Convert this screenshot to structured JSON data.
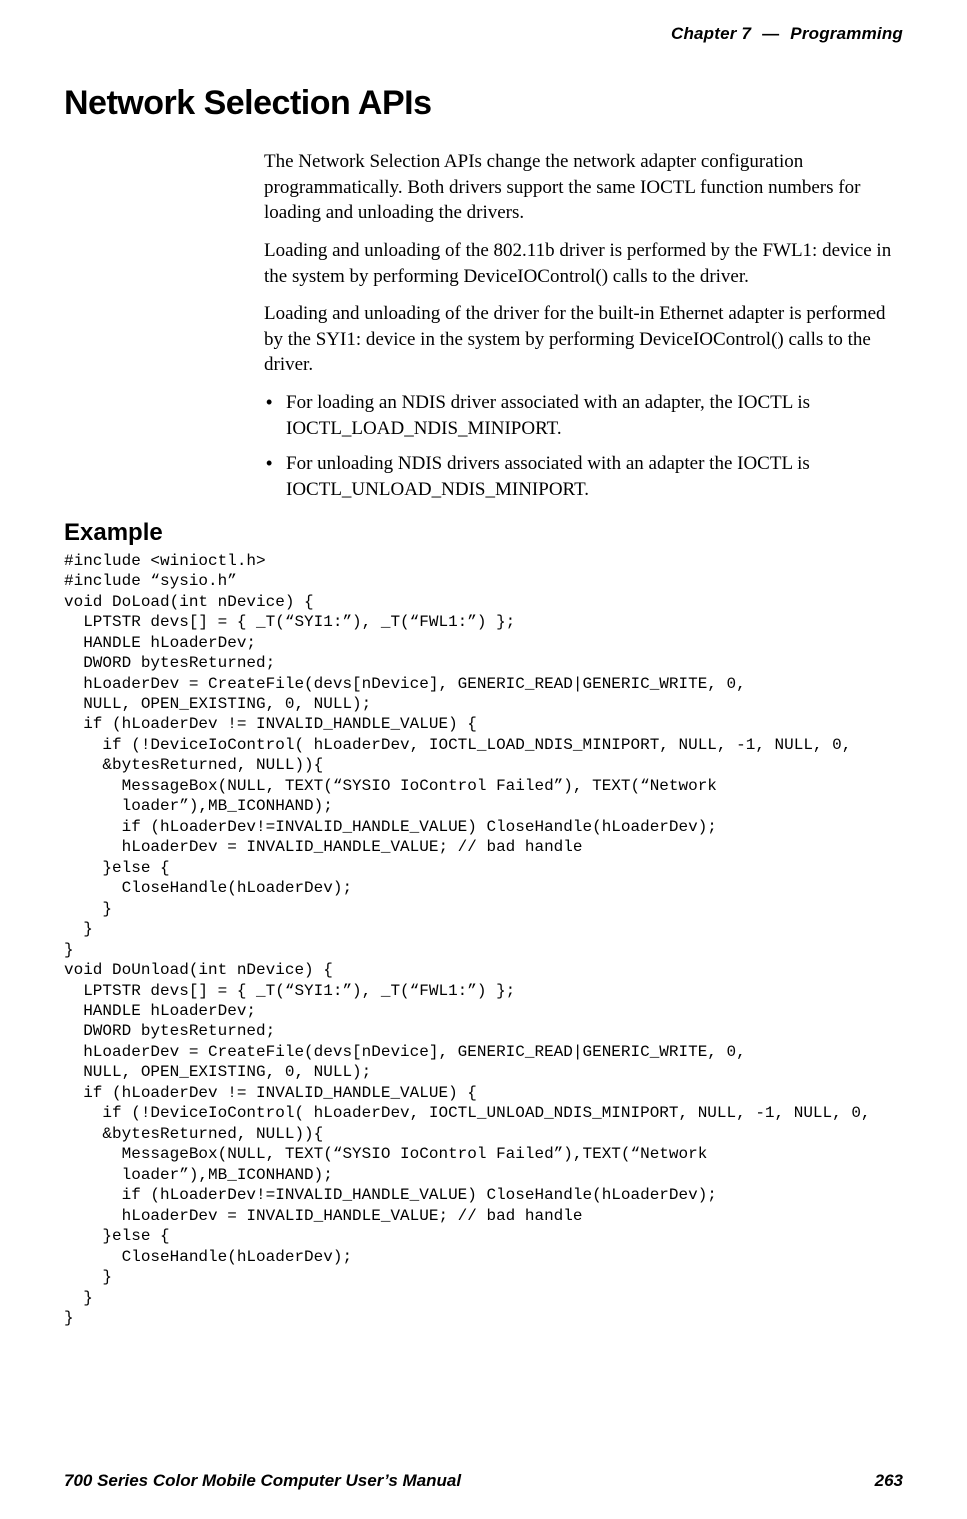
{
  "header": {
    "chapter_word": "Chapter",
    "chapter_number": "7",
    "separator": "—",
    "chapter_title": "Programming"
  },
  "section": {
    "title": "Network Selection APIs",
    "p1": "The Network Selection APIs change the network adapter configuration programmatically. Both drivers support the same IOCTL function numbers for loading and unloading the drivers.",
    "p2": "Loading and unloading of the 802.11b driver is performed by the FWL1: device in the system by performing DeviceIOControl() calls to the driver.",
    "p3": "Loading and unloading of the driver for the built-in Ethernet adapter is performed by the SYI1: device in the system by performing DeviceIOControl() calls to the driver.",
    "bullets": [
      "For loading an NDIS driver associated with an adapter, the IOCTL is IOCTL_LOAD_NDIS_MINIPORT.",
      "For unloading NDIS drivers associated with an adapter the IOCTL is IOCTL_UNLOAD_NDIS_MINIPORT."
    ]
  },
  "example": {
    "title": "Example",
    "code": "#include <winioctl.h>\n#include “sysio.h”\nvoid DoLoad(int nDevice) {\n  LPTSTR devs[] = { _T(“SYI1:”), _T(“FWL1:”) };\n  HANDLE hLoaderDev;\n  DWORD bytesReturned;\n  hLoaderDev = CreateFile(devs[nDevice], GENERIC_READ|GENERIC_WRITE, 0,\n  NULL, OPEN_EXISTING, 0, NULL);\n  if (hLoaderDev != INVALID_HANDLE_VALUE) {\n    if (!DeviceIoControl( hLoaderDev, IOCTL_LOAD_NDIS_MINIPORT, NULL, -1, NULL, 0,\n    &bytesReturned, NULL)){\n      MessageBox(NULL, TEXT(“SYSIO IoControl Failed”), TEXT(“Network\n      loader”),MB_ICONHAND);\n      if (hLoaderDev!=INVALID_HANDLE_VALUE) CloseHandle(hLoaderDev);\n      hLoaderDev = INVALID_HANDLE_VALUE; // bad handle\n    }else {\n      CloseHandle(hLoaderDev);\n    }\n  }\n}\nvoid DoUnload(int nDevice) {\n  LPTSTR devs[] = { _T(“SYI1:”), _T(“FWL1:”) };\n  HANDLE hLoaderDev;\n  DWORD bytesReturned;\n  hLoaderDev = CreateFile(devs[nDevice], GENERIC_READ|GENERIC_WRITE, 0,\n  NULL, OPEN_EXISTING, 0, NULL);\n  if (hLoaderDev != INVALID_HANDLE_VALUE) {\n    if (!DeviceIoControl( hLoaderDev, IOCTL_UNLOAD_NDIS_MINIPORT, NULL, -1, NULL, 0,\n    &bytesReturned, NULL)){\n      MessageBox(NULL, TEXT(“SYSIO IoControl Failed”),TEXT(“Network\n      loader”),MB_ICONHAND);\n      if (hLoaderDev!=INVALID_HANDLE_VALUE) CloseHandle(hLoaderDev);\n      hLoaderDev = INVALID_HANDLE_VALUE; // bad handle\n    }else {\n      CloseHandle(hLoaderDev);\n    }\n  }\n}"
  },
  "footer": {
    "manual_title": "700 Series Color Mobile Computer User’s Manual",
    "page_number": "263"
  }
}
